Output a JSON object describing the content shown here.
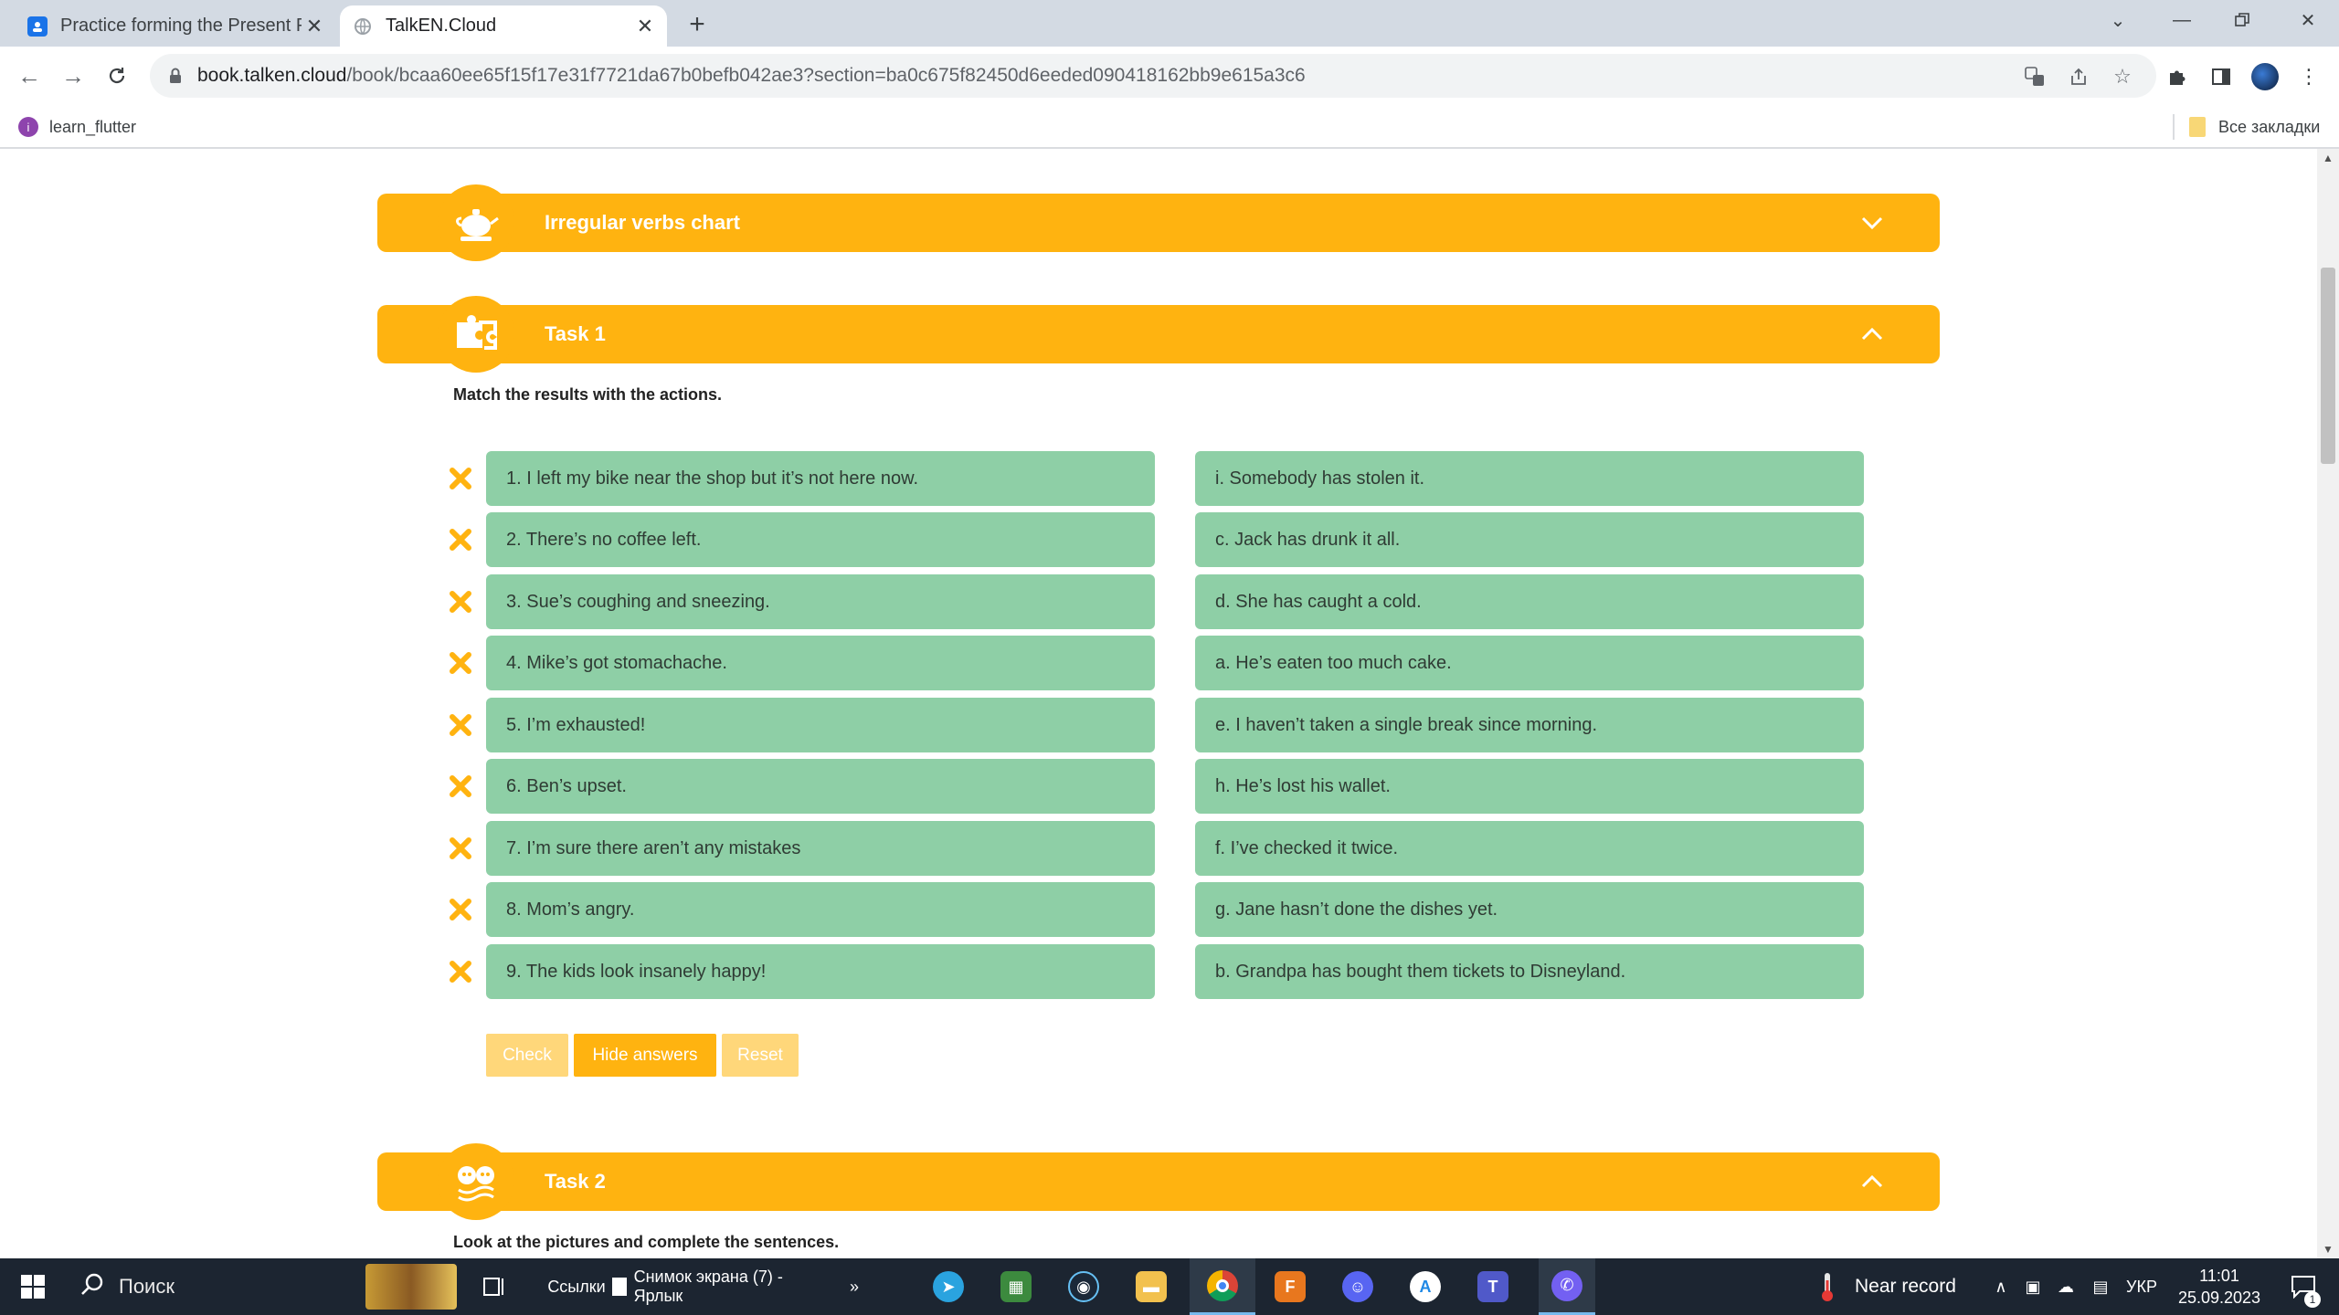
{
  "browser": {
    "tabs": [
      {
        "title": "Practice forming the Present Perf",
        "active": false
      },
      {
        "title": "TalkEN.Cloud",
        "active": true
      }
    ],
    "url_host": "book.talken.cloud",
    "url_path": "/book/bcaa60ee65f15f17e31f7721da67b0befb042ae3?section=ba0c675f82450d6eeded090418162bb9e615a3c6",
    "bookmarks": {
      "left_item": "learn_flutter",
      "right_item": "Все закладки"
    }
  },
  "page": {
    "sections": [
      {
        "label": "Irregular verbs chart",
        "expanded": false,
        "icon": "teapot-icon"
      },
      {
        "label": "Task 1",
        "expanded": true,
        "icon": "puzzle-icon"
      },
      {
        "label": "Task 2",
        "expanded": true,
        "icon": "faces-icon"
      }
    ],
    "task1": {
      "instruction": "Match the results with the actions.",
      "left_items": [
        "1. I left my bike near the shop but it’s not here now.",
        "2. There’s no coffee left.",
        "3. Sue’s coughing and sneezing.",
        "4. Mike’s got stomachache.",
        "5. I’m exhausted!",
        "6. Ben’s upset.",
        "7. I’m sure there aren’t any mistakes",
        "8. Mom’s angry.",
        "9. The kids look insanely happy!"
      ],
      "right_items": [
        "i. Somebody has stolen it.",
        "c. Jack has drunk it all.",
        "d. She has caught a cold.",
        "a. He’s eaten too much cake.",
        "e. I haven’t taken a single break since morning.",
        "h. He’s lost his wallet.",
        "f. I’ve checked it twice.",
        "g. Jane hasn’t done the dishes yet.",
        "b. Grandpa has bought them tickets to Disneyland."
      ],
      "buttons": {
        "check": "Check",
        "hide_answers": "Hide answers",
        "reset": "Reset"
      }
    },
    "task2": {
      "instruction": "Look at the pictures and complete the sentences."
    }
  },
  "taskbar": {
    "search_placeholder": "Поиск",
    "links_label": "Ссылки",
    "pinned_item": "Снимок экрана (7) - Ярлык",
    "weather": "Near record",
    "lang": "УКР",
    "time": "11:01",
    "date": "25.09.2023",
    "notif_count": "1"
  },
  "colors": {
    "accent": "#ffb310",
    "accent_pale": "#ffd77a",
    "card": "#8ecfa6",
    "taskbar": "#1c2531"
  }
}
